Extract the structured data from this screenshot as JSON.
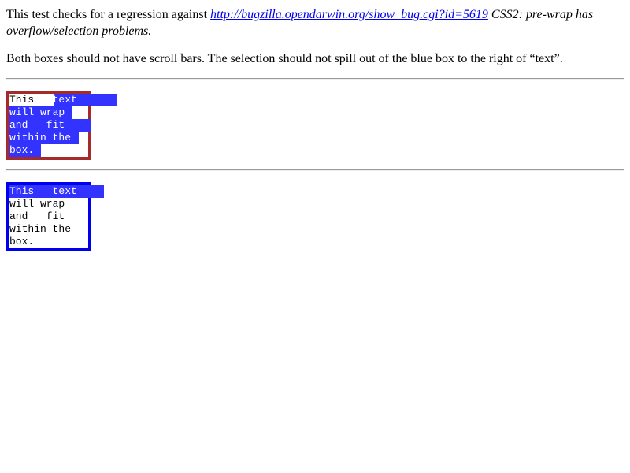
{
  "intro": {
    "prefix": "This test checks for a regression against ",
    "link_text": "http://bugzilla.opendarwin.org/show_bug.cgi?id=5619",
    "title": " CSS2: pre-wrap has overflow/selection problems",
    "suffix": "."
  },
  "note": "Both boxes should not have scroll bars. The selection should not spill out of the blue box to the right of “text”.",
  "box_red": {
    "border_color": "#a52a2a",
    "selection_color": "#3333ff",
    "lines": [
      {
        "plain": "This   ",
        "selected": "text"
      },
      {
        "plain": "",
        "selected": "will wrap"
      },
      {
        "plain": "",
        "selected": "and   fit"
      },
      {
        "plain": "",
        "selected": "within the"
      },
      {
        "plain": "",
        "selected": "box."
      }
    ]
  },
  "box_blue": {
    "border_color": "#0000ee",
    "selection_color": "#3333ff",
    "lines": [
      {
        "plain": "",
        "selected": "This   text"
      },
      {
        "plain": "will wrap",
        "selected": ""
      },
      {
        "plain": "and   fit",
        "selected": ""
      },
      {
        "plain": "within the",
        "selected": ""
      },
      {
        "plain": "box.",
        "selected": ""
      }
    ]
  }
}
